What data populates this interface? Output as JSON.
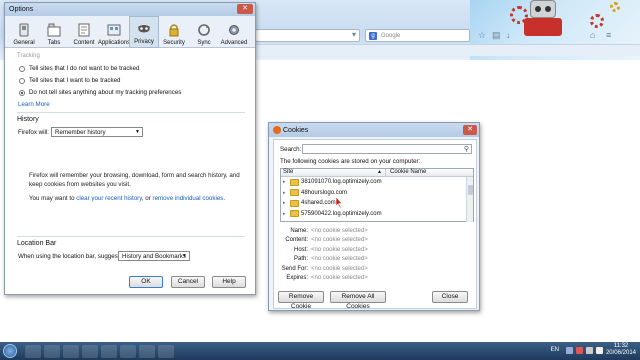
{
  "browser": {
    "search_placeholder": "Google"
  },
  "options": {
    "title": "Options",
    "close_glyph": "✕",
    "tabs": [
      {
        "label": "General",
        "icon": "switch-icon"
      },
      {
        "label": "Tabs",
        "icon": "tabs-icon"
      },
      {
        "label": "Content",
        "icon": "content-icon"
      },
      {
        "label": "Applications",
        "icon": "applications-icon"
      },
      {
        "label": "Privacy",
        "icon": "privacy-mask-icon"
      },
      {
        "label": "Security",
        "icon": "lock-icon"
      },
      {
        "label": "Sync",
        "icon": "sync-icon"
      },
      {
        "label": "Advanced",
        "icon": "gear-icon"
      }
    ],
    "tracking": {
      "heading": "Tracking",
      "options": [
        "Tell sites that I do not want to be tracked",
        "Tell sites that I want to be tracked",
        "Do not tell sites anything about my tracking preferences"
      ],
      "selected_index": 2,
      "learn_more": "Learn More"
    },
    "history": {
      "heading": "History",
      "firefox_will_label": "Firefox will:",
      "firefox_will_value": "Remember history",
      "description": "Firefox will remember your browsing, download, form and search history, and keep cookies from websites you visit.",
      "clear_prefix": "You may want to",
      "clear_link": "clear your recent history",
      "or_text": ", or",
      "remove_link": "remove individual cookies",
      "period": "."
    },
    "location_bar": {
      "heading": "Location Bar",
      "suggest_label": "When using the location bar, suggest:",
      "suggest_value": "History and Bookmarks"
    },
    "buttons": {
      "ok": "OK",
      "cancel": "Cancel",
      "help": "Help"
    }
  },
  "cookies": {
    "title": "Cookies",
    "close_glyph": "✕",
    "search_label": "Search:",
    "search_value": "",
    "stored_label": "The following cookies are stored on your computer:",
    "columns": {
      "site": "Site",
      "cookie_name": "Cookie Name"
    },
    "sites": [
      "381091070.log.optimizely.com",
      "48hourslogo.com",
      "4shared.com",
      "575900422.log.optimizely.com"
    ],
    "details": [
      {
        "key": "Name:",
        "value": "<no cookie selected>"
      },
      {
        "key": "Content:",
        "value": "<no cookie selected>"
      },
      {
        "key": "Host:",
        "value": "<no cookie selected>"
      },
      {
        "key": "Path:",
        "value": "<no cookie selected>"
      },
      {
        "key": "Send For:",
        "value": "<no cookie selected>"
      },
      {
        "key": "Expires:",
        "value": "<no cookie selected>"
      }
    ],
    "buttons": {
      "remove": "Remove Cookie",
      "remove_all": "Remove All Cookies",
      "close": "Close"
    }
  },
  "taskbar": {
    "language": "EN",
    "time": "11:32",
    "date": "20/06/2014"
  },
  "colors": {
    "link": "#1a5fb4",
    "taskbar": "#1e3a5c",
    "folder": "#e8c24a",
    "titlebar": "#b4cbe6"
  }
}
